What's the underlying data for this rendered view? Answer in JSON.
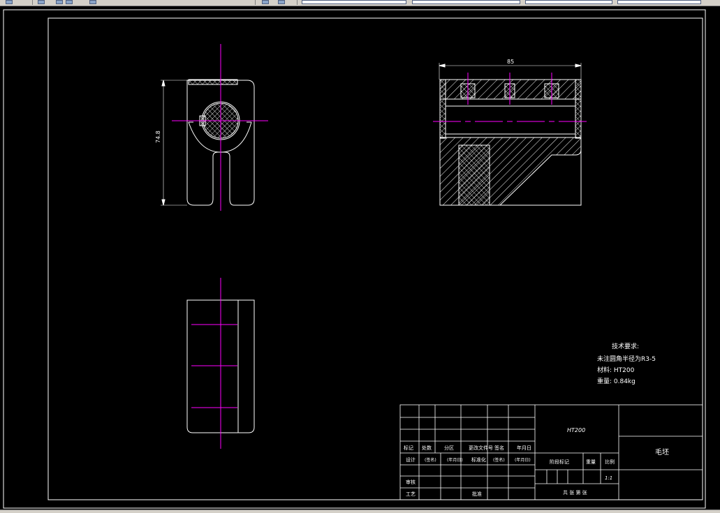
{
  "drawing": {
    "dimensions": {
      "total_height": "74.8",
      "total_width": "85"
    },
    "tech_notes": {
      "heading": "技术要求:",
      "fillet": "未注圆角半径为R3-5",
      "material": "材料: HT200",
      "weight": "重量: 0.84kg"
    },
    "title_block": {
      "material_code": "HT200",
      "part_name": "毛坯",
      "scale": "1:1",
      "headers": [
        "标记",
        "处数",
        "分区",
        "更改文件号",
        "签名",
        "年月日"
      ],
      "row_design": [
        "设计",
        "(签名)",
        "(年月日)",
        "标准化",
        "(签名)",
        "(年月日)"
      ],
      "row_review": "审核",
      "row_process": [
        "工艺",
        "批准"
      ],
      "stage_mark": "阶段标记",
      "weight_label": "重量",
      "scale_label": "比例",
      "sheet_info": "共  张  第  张"
    }
  },
  "colors": {
    "outline": "#ffffff",
    "centerline": "#ff00ff",
    "background": "#000000"
  }
}
